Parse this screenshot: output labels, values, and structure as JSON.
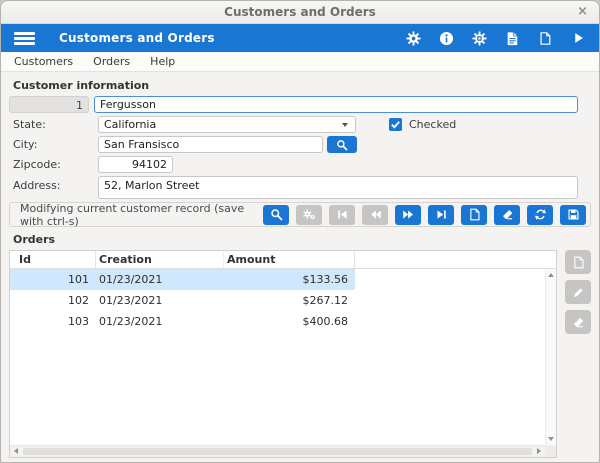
{
  "window": {
    "title": "Customers and Orders",
    "close_glyph": "×"
  },
  "appbar": {
    "title": "Customers and Orders"
  },
  "menubar": {
    "items": [
      "Customers",
      "Orders",
      "Help"
    ]
  },
  "customer": {
    "section_title": "Customer information",
    "id_value": "1",
    "name_value": "Fergusson",
    "state": {
      "label": "State:",
      "value": "California"
    },
    "checkbox": {
      "label": "Checked",
      "checked": true
    },
    "city": {
      "label": "City:",
      "value": "San Fransisco"
    },
    "zipcode": {
      "label": "Zipcode:",
      "value": "94102"
    },
    "address": {
      "label": "Address:",
      "value": "52, Marlon Street"
    },
    "status_text": "Modifying current customer record (save with ctrl-s)"
  },
  "orders": {
    "section_title": "Orders",
    "columns": [
      "Id",
      "Creation",
      "Amount"
    ],
    "rows": [
      {
        "id": "101",
        "creation": "01/23/2021",
        "amount": "$133.56",
        "selected": true
      },
      {
        "id": "102",
        "creation": "01/23/2021",
        "amount": "$267.12",
        "selected": false
      },
      {
        "id": "103",
        "creation": "01/23/2021",
        "amount": "$400.68",
        "selected": false
      }
    ]
  },
  "colors": {
    "accent": "#1976d2",
    "selected_row": "#cfe8fd",
    "disabled_button": "#c6c5c3",
    "focus_border": "#4a90d9"
  }
}
